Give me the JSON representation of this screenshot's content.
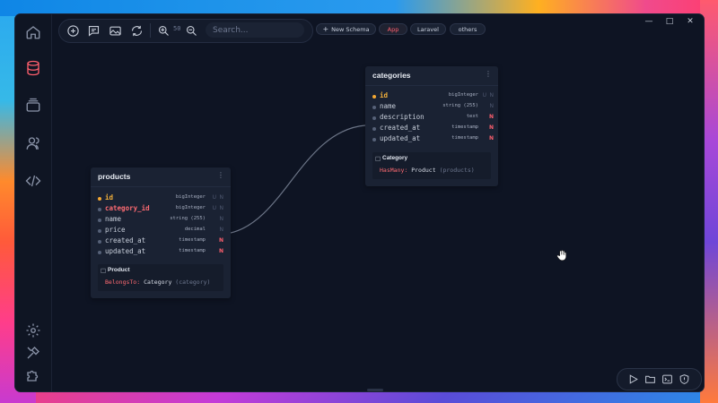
{
  "toolbar": {
    "search_placeholder": "Search...",
    "zoom_level": "50"
  },
  "chips": [
    {
      "label": "New Schema",
      "icon": "plus-icon"
    },
    {
      "label": "App",
      "active": true
    },
    {
      "label": "Laravel"
    },
    {
      "label": "others"
    }
  ],
  "tables": {
    "categories": {
      "title": "categories",
      "columns": [
        {
          "name": "id",
          "type": "bigInteger",
          "flags": [
            "U",
            "N"
          ]
        },
        {
          "name": "name",
          "type": "string (255)",
          "flags": [
            "N"
          ]
        },
        {
          "name": "description",
          "type": "text",
          "flags": [
            "N"
          ]
        },
        {
          "name": "created_at",
          "type": "timestamp",
          "flags": [
            "N"
          ]
        },
        {
          "name": "updated_at",
          "type": "timestamp",
          "flags": [
            "N"
          ]
        }
      ],
      "relation": {
        "model": "Category",
        "kind": "HasMany:",
        "target": "Product",
        "arg": "(products)"
      }
    },
    "products": {
      "title": "products",
      "columns": [
        {
          "name": "id",
          "type": "bigInteger",
          "flags": [
            "U",
            "N"
          ]
        },
        {
          "name": "category_id",
          "type": "bigInteger",
          "flags": [
            "U",
            "N"
          ]
        },
        {
          "name": "name",
          "type": "string (255)",
          "flags": [
            "N"
          ]
        },
        {
          "name": "price",
          "type": "decimal",
          "flags": [
            "N"
          ]
        },
        {
          "name": "created_at",
          "type": "timestamp",
          "flags": [
            "N"
          ]
        },
        {
          "name": "updated_at",
          "type": "timestamp",
          "flags": [
            "N"
          ]
        }
      ],
      "relation": {
        "model": "Product",
        "kind": "BelongsTo:",
        "target": "Category",
        "arg": "(category)"
      }
    }
  },
  "colors": {
    "accent": "#ff5f6d",
    "primary_key": "#f4b13a",
    "background": "#0e1423",
    "card": "#1a2233"
  }
}
